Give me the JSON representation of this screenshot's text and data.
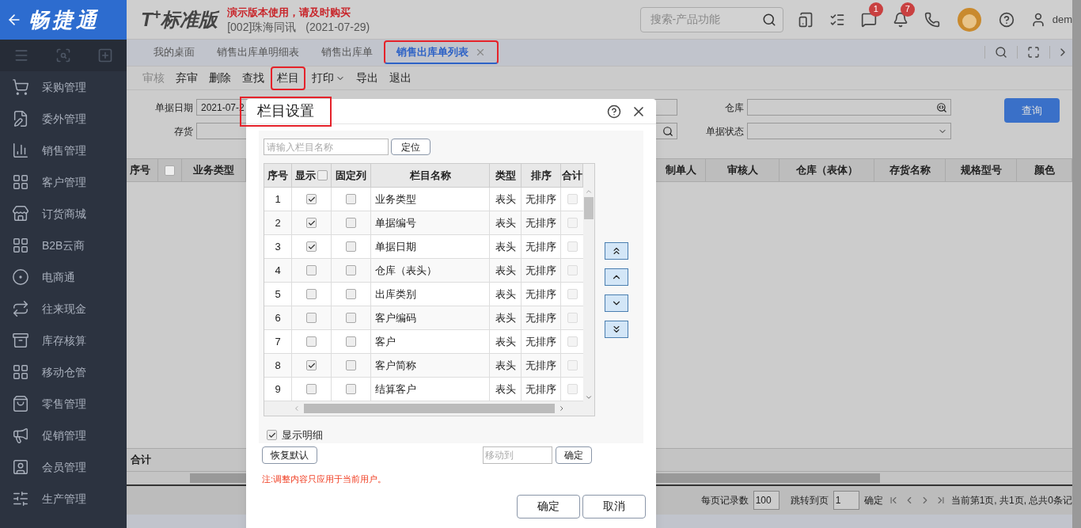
{
  "logo": {
    "text": "畅捷通"
  },
  "header": {
    "product": "T$^{+}$标准版",
    "notice": "演示版本使用，请及时购买",
    "company": "[002]珠海同讯",
    "date": "(2021-07-29)",
    "search_placeholder": "搜索-产品功能",
    "badges": [
      "1",
      "7"
    ],
    "user": "dem"
  },
  "sidebar": {
    "items": [
      {
        "label": "采购管理"
      },
      {
        "label": "委外管理"
      },
      {
        "label": "销售管理"
      },
      {
        "label": "客户管理"
      },
      {
        "label": "订货商城"
      },
      {
        "label": "B2B云商"
      },
      {
        "label": "电商通"
      },
      {
        "label": "往来现金"
      },
      {
        "label": "库存核算"
      },
      {
        "label": "移动仓管"
      },
      {
        "label": "零售管理"
      },
      {
        "label": "促销管理"
      },
      {
        "label": "会员管理"
      },
      {
        "label": "生产管理"
      }
    ]
  },
  "tabs": [
    {
      "label": "我的桌面",
      "selected": false,
      "annotated": false,
      "closable": false
    },
    {
      "label": "销售出库单明细表",
      "selected": false,
      "annotated": false,
      "closable": false
    },
    {
      "label": "销售出库单",
      "selected": false,
      "annotated": false,
      "closable": false
    },
    {
      "label": "销售出库单列表",
      "selected": true,
      "annotated": true,
      "closable": true
    }
  ],
  "toolbar": [
    {
      "label": "审核",
      "disabled": true,
      "annotated": false,
      "dropdown": false
    },
    {
      "label": "弃审",
      "disabled": false,
      "annotated": false,
      "dropdown": false
    },
    {
      "label": "删除",
      "disabled": false,
      "annotated": false,
      "dropdown": false
    },
    {
      "label": "查找",
      "disabled": false,
      "annotated": false,
      "dropdown": false
    },
    {
      "label": "栏目",
      "disabled": false,
      "annotated": true,
      "dropdown": false
    },
    {
      "label": "打印",
      "disabled": false,
      "annotated": false,
      "dropdown": true
    },
    {
      "label": "导出",
      "disabled": false,
      "annotated": false,
      "dropdown": false
    },
    {
      "label": "退出",
      "disabled": false,
      "annotated": false,
      "dropdown": false
    }
  ],
  "filters": {
    "date_label": "单据日期",
    "date_value": "2021-07-2",
    "stock_label": "存货",
    "warehouse_label": "仓库",
    "status_label": "单据状态",
    "query_button": "查询"
  },
  "grid": {
    "select_all": false,
    "left_columns": [
      "序号",
      "业务类型"
    ],
    "right_columns": [
      "制单人",
      "审核人",
      "仓库（表体）",
      "存货名称",
      "规格型号",
      "颜色"
    ],
    "total_label": "合计"
  },
  "pager": {
    "page_size_label": "每页记录数",
    "page_size": "100",
    "jump_label": "跳转到页",
    "page": "1",
    "confirm": "确定",
    "summary": "当前第1页, 共1页, 总共0条记"
  },
  "dialog": {
    "title": "栏目设置",
    "annotated": true,
    "search_placeholder": "请输入栏目名称",
    "locate_button": "定位",
    "columns": [
      "序号",
      "显示",
      "固定列",
      "栏目名称",
      "类型",
      "排序",
      "合计"
    ],
    "rows": [
      {
        "no": "1",
        "show": true,
        "fixed": false,
        "name": "业务类型",
        "type": "表头",
        "sort": "无排序",
        "total": false
      },
      {
        "no": "2",
        "show": true,
        "fixed": false,
        "name": "单据编号",
        "type": "表头",
        "sort": "无排序",
        "total": false
      },
      {
        "no": "3",
        "show": true,
        "fixed": false,
        "name": "单据日期",
        "type": "表头",
        "sort": "无排序",
        "total": false
      },
      {
        "no": "4",
        "show": false,
        "fixed": false,
        "name": "仓库（表头）",
        "type": "表头",
        "sort": "无排序",
        "total": false
      },
      {
        "no": "5",
        "show": false,
        "fixed": false,
        "name": "出库类别",
        "type": "表头",
        "sort": "无排序",
        "total": false
      },
      {
        "no": "6",
        "show": false,
        "fixed": false,
        "name": "客户编码",
        "type": "表头",
        "sort": "无排序",
        "total": false
      },
      {
        "no": "7",
        "show": false,
        "fixed": false,
        "name": "客户",
        "type": "表头",
        "sort": "无排序",
        "total": false
      },
      {
        "no": "8",
        "show": true,
        "fixed": false,
        "name": "客户简称",
        "type": "表头",
        "sort": "无排序",
        "total": false
      },
      {
        "no": "9",
        "show": false,
        "fixed": false,
        "name": "结算客户",
        "type": "表头",
        "sort": "无排序",
        "total": false
      }
    ],
    "show_all": false,
    "show_detail": {
      "label": "显示明细",
      "checked": true
    },
    "restore_button": "恢复默认",
    "move_placeholder": "移动到",
    "move_confirm": "确定",
    "note": "注:调整内容只应用于当前用户。",
    "ok_button": "确定",
    "cancel_button": "取消"
  }
}
